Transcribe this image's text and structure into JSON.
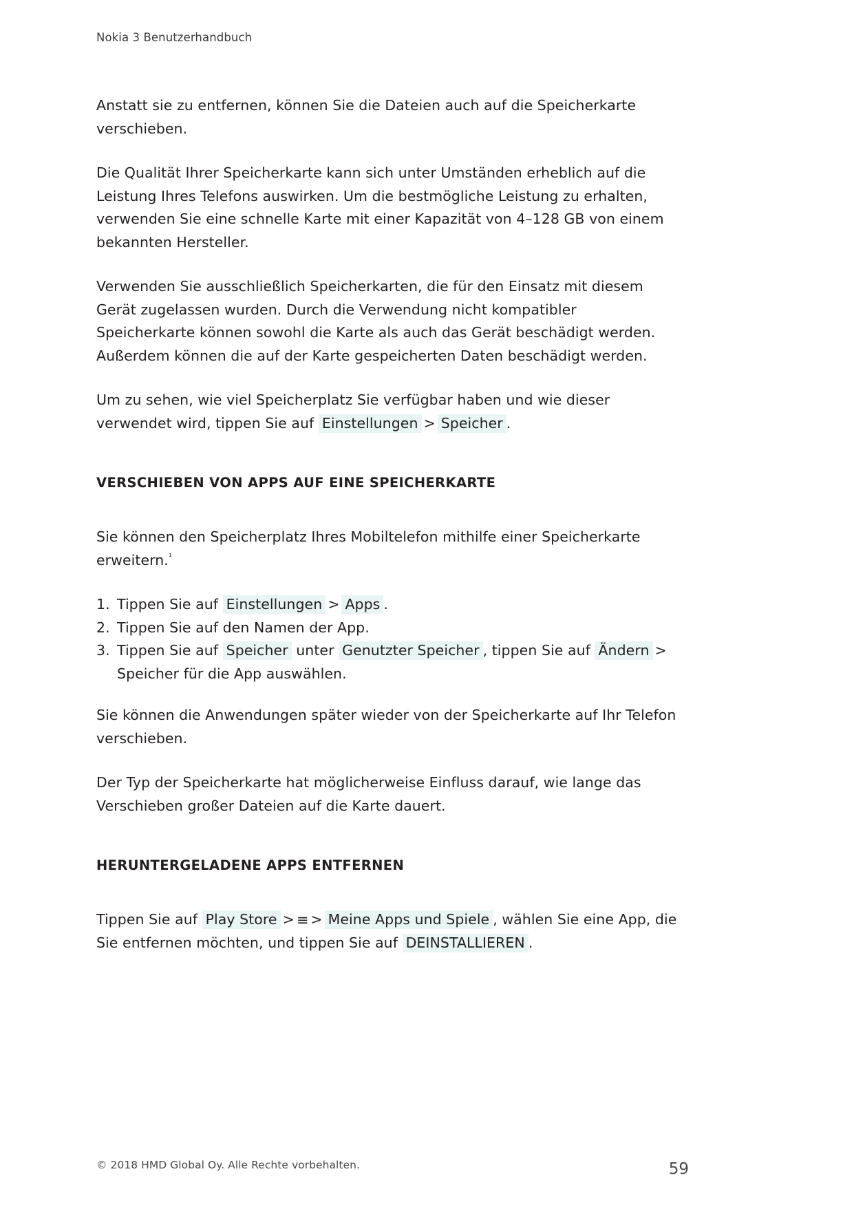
{
  "header": {
    "running_title": "Nokia 3 Benutzerhandbuch"
  },
  "content": {
    "para_move_files": "Anstatt sie zu entfernen, können Sie die Dateien auch auf die Speicherkarte verschieben.",
    "para_quality": "Die Qualität Ihrer Speicherkarte kann sich unter Umständen erheblich auf die Leistung Ihres Telefons auswirken. Um die bestmögliche Leistung zu erhalten, verwenden Sie eine schnelle Karte mit einer Kapazität von 4–128 GB von einem bekannten Hersteller.",
    "para_compat": "Verwenden Sie ausschließlich Speicherkarten, die für den Einsatz mit diesem Gerät zugelassen wurden. Durch die Verwendung nicht kompatibler Speicherkarte können sowohl die Karte als auch das Gerät beschädigt werden. Außerdem können die auf der Karte gespeicherten Daten beschädigt werden.",
    "para_storage_lead": "Um zu sehen, wie viel Speicherplatz Sie verfügbar haben und wie dieser verwendet wird, tippen Sie auf",
    "chip_einstellungen_1": "Einstellungen",
    "separator_1": ">",
    "chip_speicher_1": "Speicher",
    "period_1": ".",
    "heading_move_apps": "VERSCHIEBEN VON APPS AUF EINE SPEICHERKARTE",
    "para_expand_lead": "Sie können den Speicherplatz Ihres Mobiltelefon mithilfe einer Speicherkarte erweitern.",
    "footnote_marker": "¹",
    "step1_num": "1.",
    "step1_lead": "Tippen Sie auf",
    "step1_chip_einstellungen": "Einstellungen",
    "step1_sep": ">",
    "step1_chip_apps": "Apps",
    "step1_end": ".",
    "step2_num": "2.",
    "step2_text": "Tippen Sie auf den Namen der App.",
    "step3_num": "3.",
    "step3_lead": "Tippen Sie auf",
    "step3_chip_speicher": "Speicher",
    "step3_mid": "unter",
    "step3_chip_genutzter": "Genutzter Speicher",
    "step3_mid2": ", tippen Sie auf",
    "step3_chip_aendern": "Ändern",
    "step3_sep": ">",
    "step3_cont": "Speicher für die App auswählen.",
    "para_move_back": "Sie können die Anwendungen später wieder von der Speicherkarte auf Ihr Telefon verschieben.",
    "para_card_type": "Der Typ der Speicherkarte hat möglicherweise Einfluss darauf, wie lange das Verschieben großer Dateien auf die Karte dauert.",
    "heading_remove_apps": "HERUNTERGELADENE APPS ENTFERNEN",
    "para_uninstall_lead": "Tippen Sie auf",
    "chip_play_store": "Play Store",
    "sep_2": ">",
    "hamburger_icon": "≡",
    "sep_3": ">",
    "chip_meine_apps": "Meine Apps und Spiele",
    "para_uninstall_mid": ", wählen Sie eine App, die Sie entfernen möchten, und tippen Sie auf",
    "chip_deinstallieren": "DEINSTALLIEREN",
    "period_2": "."
  },
  "footer": {
    "copyright": "© 2018 HMD Global Oy. Alle Rechte vorbehalten.",
    "page_number": "59"
  },
  "colors": {
    "chip_background": "#e9f4f4",
    "text": "#231f20",
    "muted_text": "#4a4a4a"
  }
}
